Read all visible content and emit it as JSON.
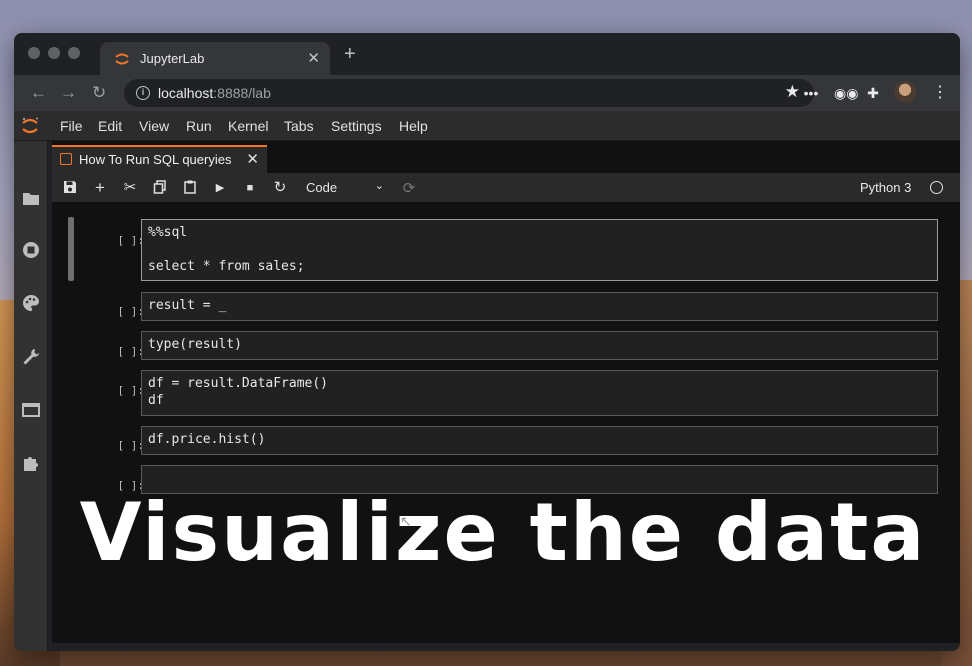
{
  "browser": {
    "tab_title": "JupyterLab",
    "url_host": "localhost",
    "url_path": ":8888/lab",
    "close_glyph": "✕",
    "new_tab_glyph": "+"
  },
  "jupyter": {
    "menu": [
      "File",
      "Edit",
      "View",
      "Run",
      "Kernel",
      "Tabs",
      "Settings",
      "Help"
    ],
    "doc_tab_title": "How To Run SQL queryies",
    "cell_type": "Code",
    "kernel_name": "Python 3",
    "prompt": "[ ]:",
    "cells": [
      {
        "lines": [
          "%%sql",
          "",
          "select * from sales;"
        ]
      },
      {
        "lines": [
          "result = _"
        ]
      },
      {
        "lines": [
          "type(result)"
        ]
      },
      {
        "lines": [
          "df = result.DataFrame()",
          "df"
        ]
      },
      {
        "lines": [
          "df.price.hist()"
        ]
      },
      {
        "lines": [
          ""
        ]
      }
    ]
  },
  "caption": "Visualize the data",
  "colors": {
    "jupyter_orange": "#f37626",
    "chrome_dark": "#202124",
    "notebook_bg": "#111111"
  }
}
